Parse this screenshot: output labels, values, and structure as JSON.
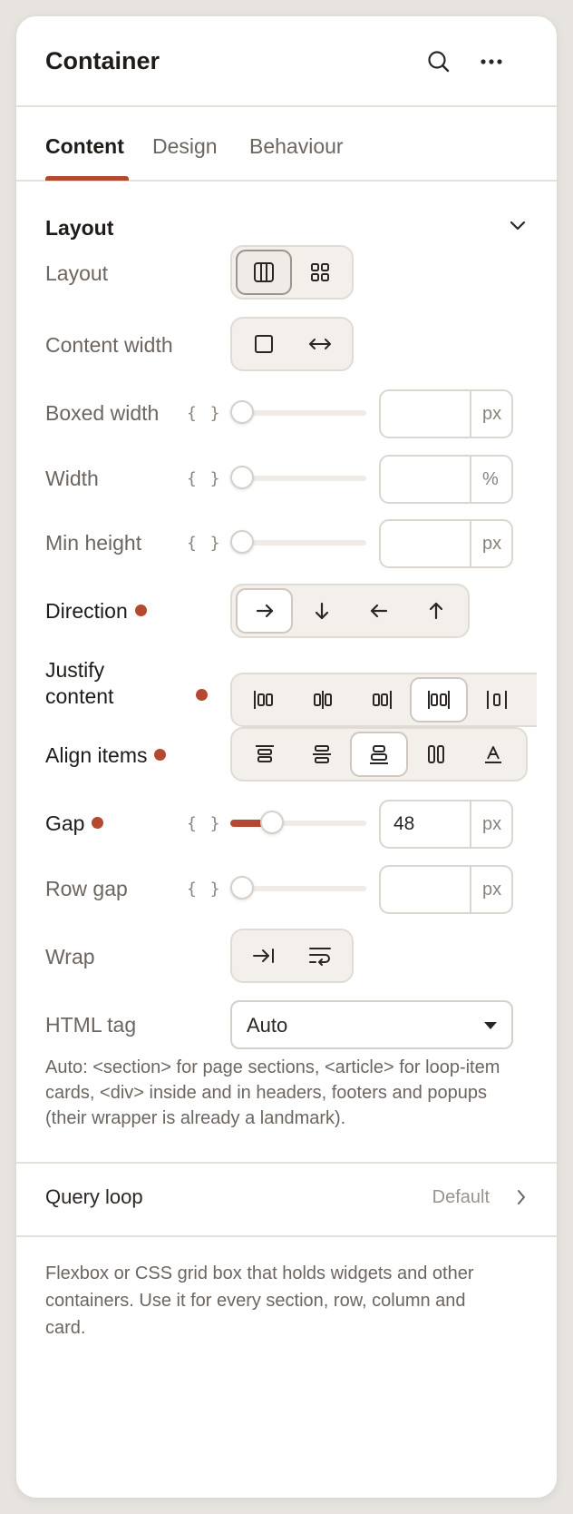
{
  "panel": {
    "title": "Container",
    "icons": [
      "search-icon",
      "more-horizontal-icon"
    ]
  },
  "tabs": [
    {
      "label": "Content",
      "active": true
    },
    {
      "label": "Design",
      "active": false
    },
    {
      "label": "Behaviour",
      "active": false
    }
  ],
  "section": {
    "title": "Layout",
    "icon": "chevron-down-icon"
  },
  "controls": {
    "layout": {
      "label": "Layout",
      "options": [
        "flexbox-icon",
        "grid-icon"
      ],
      "selected": 0
    },
    "content_width": {
      "label": "Content width",
      "options": [
        "boxed-icon",
        "full-width-icon"
      ],
      "selected": -1
    },
    "boxed_width": {
      "label": "Boxed width",
      "dynamic": "{ }",
      "value": "",
      "unit": "px",
      "slider_fraction": 0
    },
    "width": {
      "label": "Width",
      "dynamic": "{ }",
      "value": "",
      "unit": "%",
      "slider_fraction": 0
    },
    "min_height": {
      "label": "Min height",
      "dynamic": "{ }",
      "value": "",
      "unit": "px",
      "slider_fraction": 0
    },
    "direction": {
      "label": "Direction",
      "modified": true,
      "options": [
        "arrow-right-icon",
        "arrow-down-icon",
        "arrow-left-icon",
        "arrow-up-icon"
      ],
      "selected": 0
    },
    "justify_content": {
      "label_line1": "Justify",
      "label_line2": "content",
      "modified": true,
      "options": [
        "justify-start-icon",
        "justify-center-icon",
        "justify-end-icon",
        "justify-space-between-icon",
        "justify-space-around-icon"
      ],
      "selected": 3
    },
    "align_items": {
      "label": "Align items",
      "modified": true,
      "options": [
        "align-start-icon",
        "align-center-icon",
        "align-end-icon",
        "align-stretch-icon",
        "align-baseline-icon"
      ],
      "selected": 2
    },
    "gap": {
      "label": "Gap",
      "modified": true,
      "dynamic": "{ }",
      "value": "48",
      "unit": "px",
      "slider_fraction": 0.27
    },
    "row_gap": {
      "label": "Row gap",
      "dynamic": "{ }",
      "value": "",
      "unit": "px",
      "slider_fraction": 0
    },
    "wrap": {
      "label": "Wrap",
      "options": [
        "no-wrap-icon",
        "wrap-icon"
      ],
      "selected": -1
    },
    "html_tag": {
      "label": "HTML tag",
      "value": "Auto",
      "help": "Auto: <section> for page sections, <article> for loop-item cards, <div> inside and in headers, footers and popups (their wrapper is already a landmark)."
    }
  },
  "query_loop": {
    "label": "Query loop",
    "value": "Default",
    "icon": "chevron-right-icon"
  },
  "footer_text": "Flexbox or CSS grid box that holds widgets and other containers. Use it for every section, row, column and card.",
  "colors": {
    "accent": "#b34a30",
    "text": "#1f1b18",
    "muted": "#6d6560",
    "border": "#e4e0dc"
  }
}
